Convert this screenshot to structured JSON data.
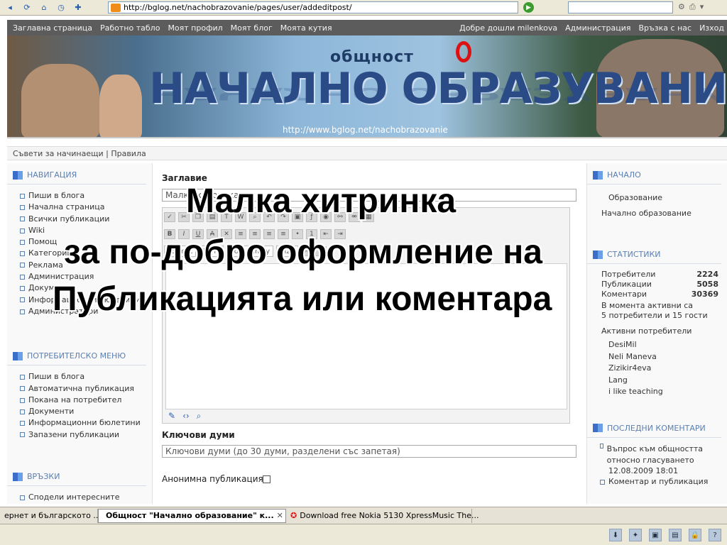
{
  "browser": {
    "address": "http://bglog.net/nachobrazovanie/pages/user/addeditpost/",
    "go_symbol": "▶",
    "nav_icons": [
      "back-icon",
      "refresh-icon",
      "home-icon",
      "history-icon",
      "bookmark-icon"
    ]
  },
  "site_nav": {
    "left": [
      "Заглавна страница",
      "Работно табло",
      "Моят профил",
      "Моят блог",
      "Моята кутия"
    ],
    "right": [
      "Добре дошли milenkova",
      "Администрация",
      "Връзка с нас",
      "Изход"
    ]
  },
  "banner": {
    "word": "общност",
    "title": "НАЧАЛНО ОБРАЗУВАНИЕ",
    "url": "http://www.bglog.net/nachobrazovanie"
  },
  "breadcrumb": "Съвети за начинаещи | Правила",
  "left": {
    "nav_title": "НАВИГАЦИЯ",
    "nav_items": [
      "Пиши в блога",
      "Начална страница",
      "Всички публикации",
      "Wiki",
      "Помощ",
      "Категории",
      "Реклама",
      "Администрация",
      "Документи",
      "Информационни бюлетини",
      "Администратори"
    ],
    "user_title": "ПОТРЕБИТЕЛСКО МЕНЮ",
    "user_items": [
      "Пиши в блога",
      "Автоматична публикация",
      "Покана на потребител",
      "Документи",
      "Информационни бюлетини",
      "Запазени публикации"
    ],
    "links_title": "ВРЪЗКИ",
    "links_items": [
      "Сподели интересните"
    ]
  },
  "main": {
    "title_label": "Заглавие",
    "title_value": "Малка хитринка",
    "font_format": "Format",
    "font_style": "Style",
    "font_family": "Font family",
    "font_size": "Size",
    "keywords_label": "Ключови думи",
    "keywords_placeholder": "Ключови думи (до 30 думи, разделени със запетая)",
    "anon_label": "Анонимна публикация?"
  },
  "right": {
    "start_title": "НАЧАЛО",
    "start_items": [
      "Образование",
      "Начално образование"
    ],
    "stats_title": "СТАТИСТИКИ",
    "stats": [
      {
        "label": "Потребители",
        "value": "2224"
      },
      {
        "label": "Публикации",
        "value": "5058"
      },
      {
        "label": "Коментари",
        "value": "30369"
      }
    ],
    "active_now": "В момента активни са",
    "active_counts": "5 потребители и 15 гости",
    "active_title": "Активни потребители",
    "active_users": [
      "DesiMil",
      "Neli Maneva",
      "Zizikir4eva",
      "Lang",
      "i like teaching"
    ],
    "comments_title": "ПОСЛЕДНИ КОМЕНТАРИ",
    "comment_text": "Въпрос към общността относно гласуването",
    "comment_date": "12.08.2009 18:01",
    "comment_next": "Коментар и публикация"
  },
  "overlay": {
    "line1": "Малка хитринка",
    "line2": "за по-добро оформление на",
    "line3": "Публикацията или коментара"
  },
  "tabs": [
    {
      "label": "ернет и българското ...",
      "active": false
    },
    {
      "label": "Общност \"Начално образование\" к...",
      "active": true
    },
    {
      "label": "Download free Nokia 5130 XpressMusic The...",
      "active": false
    }
  ]
}
